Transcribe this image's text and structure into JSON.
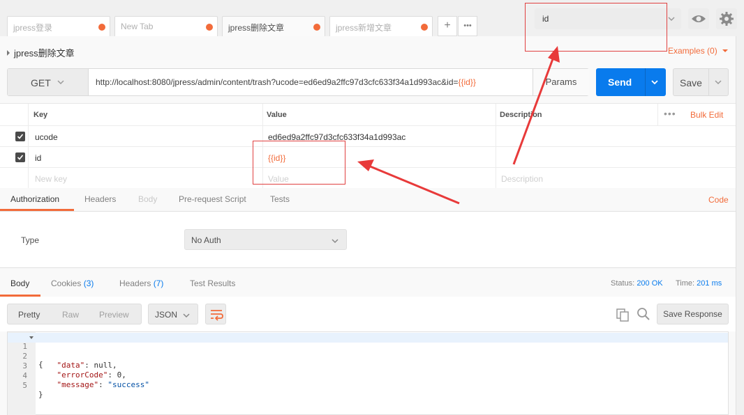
{
  "tabs": [
    {
      "label": "jpress登录",
      "active": false
    },
    {
      "label": "New Tab",
      "active": false
    },
    {
      "label": "jpress删除文章",
      "active": true
    },
    {
      "label": "jpress新增文章",
      "active": false
    }
  ],
  "tab_add_label": "+",
  "tab_more_label": "•••",
  "environment": {
    "selected": "id"
  },
  "request": {
    "name": "jpress删除文章",
    "examples_label": "Examples (0)",
    "method": "GET",
    "url_prefix": "http://localhost:8080/jpress/admin/content/trash?ucode=ed6ed9a2ffc97d3cfc633f34a1d993ac&id=",
    "url_var": "{{id}}",
    "params_label": "Params",
    "send_label": "Send",
    "save_label": "Save"
  },
  "params_table": {
    "headers": {
      "key": "Key",
      "value": "Value",
      "description": "Description",
      "more": "•••",
      "bulk_edit": "Bulk Edit"
    },
    "rows": [
      {
        "checked": true,
        "key": "ucode",
        "value": "ed6ed9a2ffc97d3cfc633f34a1d993ac",
        "description": ""
      },
      {
        "checked": true,
        "key": "id",
        "value": "{{id}}",
        "description": ""
      }
    ],
    "placeholders": {
      "key": "New key",
      "value": "Value",
      "description": "Description"
    }
  },
  "request_tabs": {
    "items": [
      "Authorization",
      "Headers",
      "Body",
      "Pre-request Script",
      "Tests"
    ],
    "active": "Authorization",
    "disabled": "Body",
    "code_link": "Code"
  },
  "auth": {
    "type_label": "Type",
    "type_value": "No Auth"
  },
  "response_tabs": {
    "body": "Body",
    "cookies": "Cookies",
    "cookies_count": "(3)",
    "headers": "Headers",
    "headers_count": "(7)",
    "test_results": "Test Results"
  },
  "status": {
    "status_label": "Status:",
    "status_value": "200 OK",
    "time_label": "Time:",
    "time_value": "201 ms"
  },
  "response_toolbar": {
    "pretty": "Pretty",
    "raw": "Raw",
    "preview": "Preview",
    "format": "JSON",
    "save_response": "Save Response"
  },
  "response_body": [
    {
      "n": "1",
      "text": "{"
    },
    {
      "n": "2",
      "key": "\"data\"",
      "rest": ": null,"
    },
    {
      "n": "3",
      "key": "\"errorCode\"",
      "rest": ": 0,"
    },
    {
      "n": "4",
      "key": "\"message\"",
      "rest": ": ",
      "str": "\"success\""
    },
    {
      "n": "5",
      "text": "}"
    }
  ],
  "colors": {
    "accent": "#f26b3a",
    "send": "#097bed",
    "annotation": "#e04040"
  }
}
